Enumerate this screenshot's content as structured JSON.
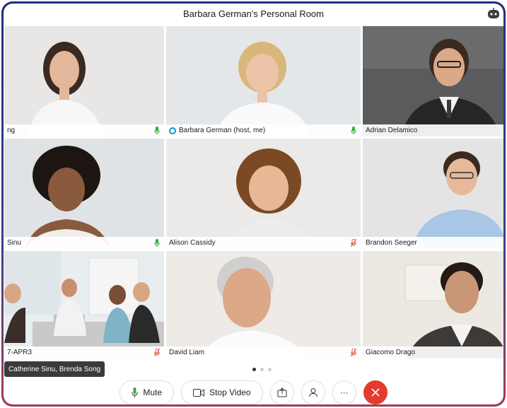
{
  "window": {
    "title": "Barbara German's Personal Room"
  },
  "participants": [
    {
      "name": "ng",
      "mic": "on"
    },
    {
      "name": "Barbara German (host, me)",
      "mic": "on",
      "host": true
    },
    {
      "name": "Adrian Delamico",
      "mic": "none"
    },
    {
      "name": "Sinu",
      "mic": "on",
      "active": true
    },
    {
      "name": "Alison Cassidy",
      "mic": "muted"
    },
    {
      "name": "Brandon Seeger",
      "mic": "none"
    },
    {
      "name": "7-APR3",
      "mic": "muted"
    },
    {
      "name": "David Liam",
      "mic": "muted"
    },
    {
      "name": "Giacomo Drago",
      "mic": "none"
    }
  ],
  "tooltip": "Catherine Sinu, Brenda Song",
  "pager": {
    "pages": 3,
    "current": 1
  },
  "controls": {
    "mute_label": "Mute",
    "stop_video_label": "Stop Video",
    "share_icon": "share-icon",
    "participants_icon": "participants-icon",
    "more_label": "···",
    "end_icon": "end-call-icon"
  },
  "colors": {
    "active_border": "#29b6e6",
    "mic_on": "#3aa83a",
    "mic_muted": "#e0533c",
    "end_button": "#e33b2e",
    "frame": "#2b2f7a"
  }
}
